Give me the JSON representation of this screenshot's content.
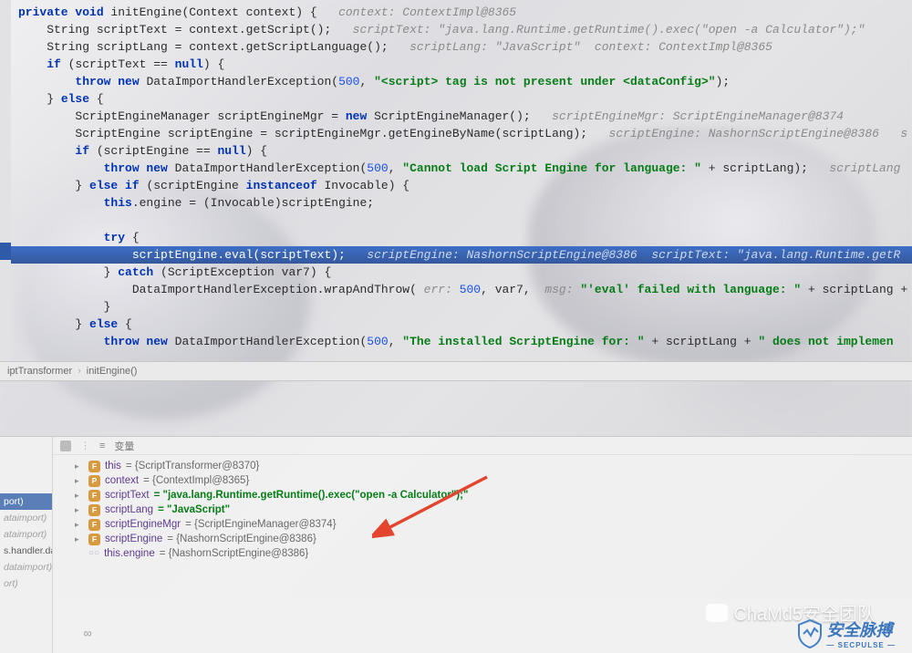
{
  "code": {
    "method_sig_pre": "private void ",
    "method_name": "initEngine",
    "method_params": "(Context context) {",
    "ann_ctx": "context: ContextImpl@8365",
    "l2a": "    String scriptText = context.getScript();",
    "ann2": "scriptText: \"java.lang.Runtime.getRuntime().exec(\"open -a Calculator\");\"",
    "l3a": "    String scriptLang = context.getScriptLanguage();",
    "ann3a": "scriptLang: \"JavaScript\"",
    "ann3b": "context: ContextImpl@8365",
    "l4": "    if (scriptText == null) {",
    "l5a": "        throw new ",
    "l5b": "DataImportHandlerException(",
    "l5c": "500",
    "l5d": ", ",
    "l5e": "\"<script> tag is not present under <dataConfig>\"",
    "l5f": ");",
    "l6": "    } else {",
    "l7a": "        ScriptEngineManager scriptEngineMgr = ",
    "l7b": "new ",
    "l7c": "ScriptEngineManager();",
    "ann7": "scriptEngineMgr: ScriptEngineManager@8374",
    "l8a": "        ScriptEngine scriptEngine = scriptEngineMgr.getEngineByName(scriptLang);",
    "ann8": "scriptEngine: NashornScriptEngine@8386   s",
    "l9": "        if (scriptEngine == null) {",
    "l10a": "            throw new ",
    "l10b": "DataImportHandlerException(",
    "l10c": "500",
    "l10d": ", ",
    "l10e": "\"Cannot load Script Engine for language: \"",
    "l10f": " + scriptLang);",
    "ann10": "scriptLang",
    "l11a": "        } ",
    "l11b": "else if ",
    "l11c": "(scriptEngine ",
    "l11d": "instanceof ",
    "l11e": "Invocable) {",
    "l12a": "            this",
    "l12b": ".engine = (Invocable)scriptEngine;",
    "l14a": "            try ",
    "l14b": "{",
    "l15a": "                scriptEngine.eval(scriptText);",
    "ann15": "scriptEngine: NashornScriptEngine@8386  scriptText: \"java.lang.Runtime.getR",
    "l16a": "            } ",
    "l16b": "catch ",
    "l16c": "(ScriptException var7) {",
    "l17a": "                DataImportHandlerException.wrapAndThrow(",
    "ann17a": " err: ",
    "l17b": "500",
    "l17c": ", var7, ",
    "ann17b": " msg: ",
    "l17d": "\"'eval' failed with language: \"",
    "l17e": " + scriptLang +",
    "l18": "            }",
    "l19a": "        } ",
    "l19b": "else ",
    "l19c": "{",
    "l20a": "            throw new ",
    "l20b": "DataImportHandlerException(",
    "l20c": "500",
    "l20d": ", ",
    "l20e": "\"The installed ScriptEngine for: \"",
    "l20f": " + scriptLang + ",
    "l20g": "\" does not implemen"
  },
  "breadcrumb": {
    "a": "iptTransformer",
    "b": "initEngine()"
  },
  "frames": {
    "f1": "port)",
    "f2": "ataimport)",
    "f3": "ataimport)",
    "f4": "s.handler.da",
    "f5": "dataimport)",
    "f6": "ort)"
  },
  "vars": {
    "title": "变量",
    "rows": [
      {
        "icon": "f",
        "name": "this",
        "val": "= {ScriptTransformer@8370}",
        "exp": true,
        "str": false
      },
      {
        "icon": "p",
        "name": "context",
        "val": "= {ContextImpl@8365}",
        "exp": true,
        "str": false
      },
      {
        "icon": "f",
        "name": "scriptText",
        "val": "= \"java.lang.Runtime.getRuntime().exec(\"open -a Calculator\");\"",
        "exp": true,
        "str": true
      },
      {
        "icon": "f",
        "name": "scriptLang",
        "val": "= \"JavaScript\"",
        "exp": true,
        "str": true
      },
      {
        "icon": "f",
        "name": "scriptEngineMgr",
        "val": "= {ScriptEngineManager@8374}",
        "exp": true,
        "str": false
      },
      {
        "icon": "f",
        "name": "scriptEngine",
        "val": "= {NashornScriptEngine@8386}",
        "exp": true,
        "str": false
      },
      {
        "icon": "f",
        "name": "this.engine",
        "val": "= {NashornScriptEngine@8386}",
        "exp": true,
        "str": false,
        "special": true
      }
    ]
  },
  "watermark": "ChaMd5安全团队",
  "secpulse": {
    "main": "安全脉搏",
    "sub": "— SECPULSE —"
  }
}
